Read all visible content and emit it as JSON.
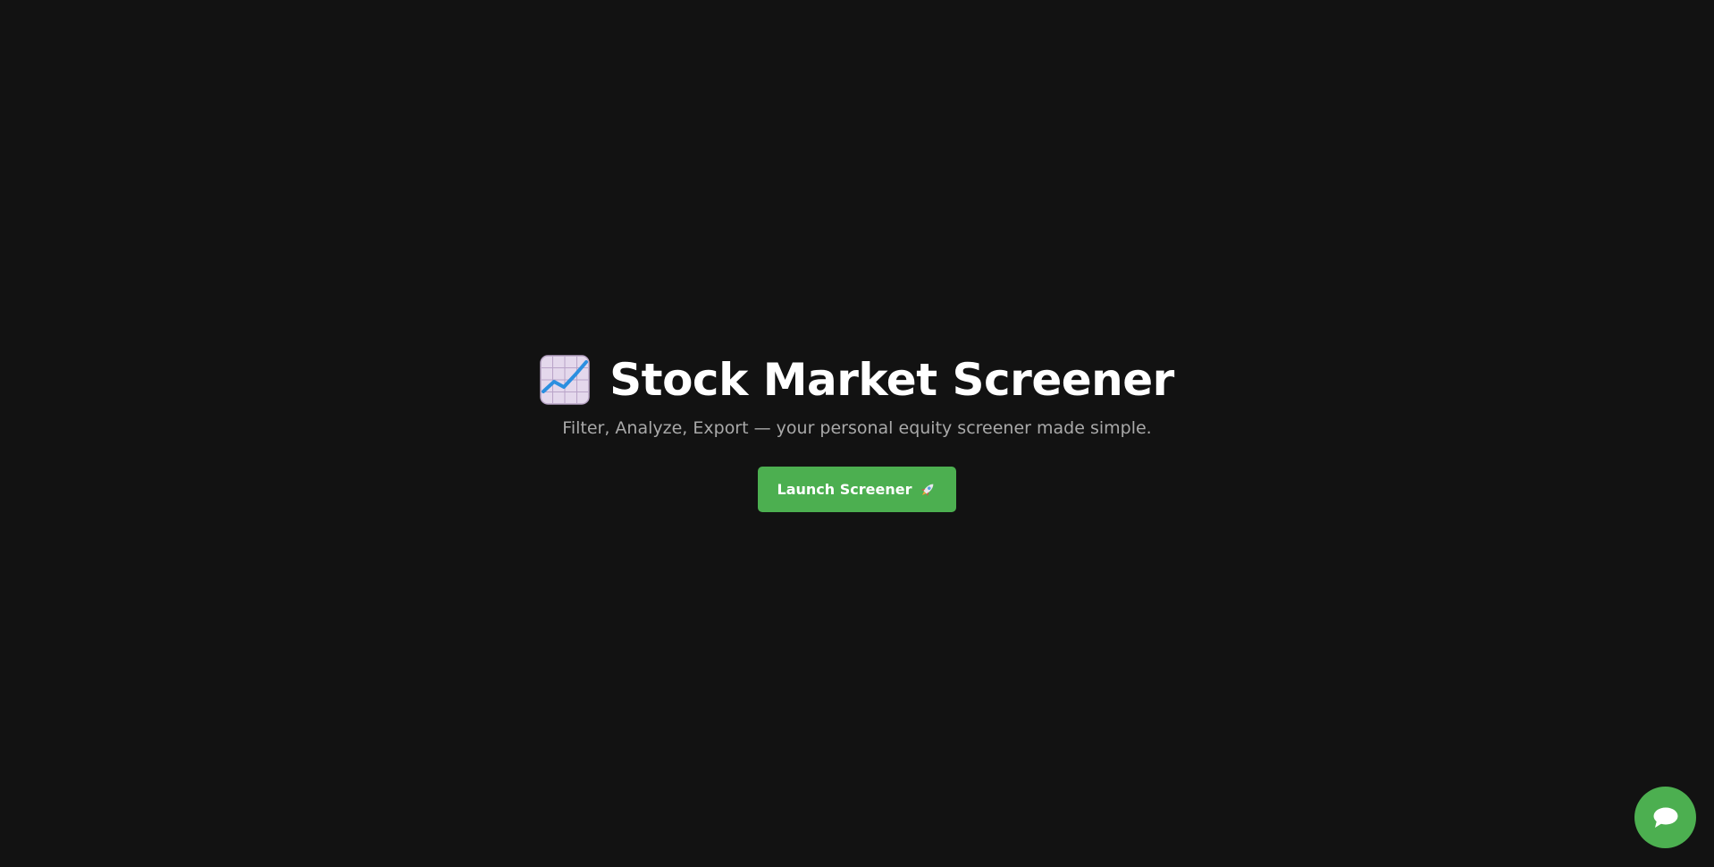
{
  "hero": {
    "title": "Stock Market Screener",
    "title_icon": "chart-increasing-icon",
    "subtitle": "Filter, Analyze, Export — your personal equity screener made simple.",
    "launch_button": {
      "label": "Launch Screener",
      "icon": "rocket-icon"
    }
  },
  "chat_widget": {
    "icon": "chat-bubble-icon"
  },
  "colors": {
    "background": "#121212",
    "accent": "#4caf50",
    "title_text": "#ffffff",
    "subtitle_text": "#a9a9a9"
  }
}
